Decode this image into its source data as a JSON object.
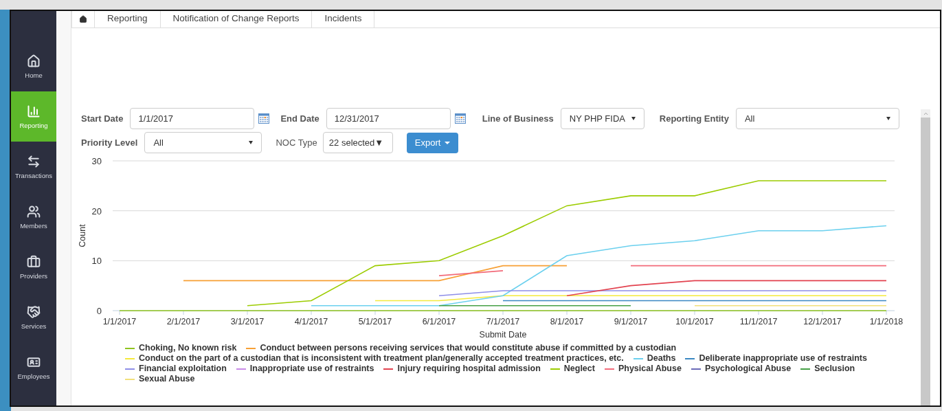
{
  "sidebar": {
    "items": [
      {
        "label": "Home",
        "selected": false
      },
      {
        "label": "Reporting",
        "selected": true
      },
      {
        "label": "Transactions",
        "selected": false
      },
      {
        "label": "Members",
        "selected": false
      },
      {
        "label": "Providers",
        "selected": false
      },
      {
        "label": "Services",
        "selected": false
      },
      {
        "label": "Employees",
        "selected": false
      }
    ]
  },
  "breadcrumb": [
    "Reporting",
    "Notification of Change Reports",
    "Incidents"
  ],
  "filters": {
    "start_date": {
      "label": "Start Date",
      "value": "1/1/2017"
    },
    "end_date": {
      "label": "End Date",
      "value": "12/31/2017"
    },
    "line_of_business": {
      "label": "Line of Business",
      "value": "NY PHP FIDA"
    },
    "reporting_entity": {
      "label": "Reporting Entity",
      "value": "All"
    },
    "priority_level": {
      "label": "Priority Level",
      "value": "All"
    },
    "noc_type": {
      "label": "NOC Type",
      "value": "22 selected▼"
    },
    "export_button": "Export"
  },
  "chart_data": {
    "type": "line",
    "xlabel": "Submit Date",
    "ylabel": "Count",
    "categories": [
      "1/1/2017",
      "2/1/2017",
      "3/1/2017",
      "4/1/2017",
      "5/1/2017",
      "6/1/2017",
      "7/1/2017",
      "8/1/2017",
      "9/1/2017",
      "10/1/2017",
      "11/1/2017",
      "12/1/2017",
      "1/1/2018"
    ],
    "ylim": [
      0,
      30
    ],
    "yticks": [
      0,
      10,
      20,
      30
    ],
    "series": [
      {
        "name": "Choking, No known risk",
        "color": "#8fc31f",
        "values": [
          0,
          0,
          0,
          0,
          0,
          0,
          0,
          0,
          0,
          0,
          0,
          0,
          0
        ]
      },
      {
        "name": "Conduct between persons receiving services that would constitute abuse if committed by a custodian",
        "color": "#f7a035",
        "values": [
          null,
          6,
          6,
          6,
          6,
          6,
          9,
          9,
          null,
          null,
          null,
          null,
          null
        ]
      },
      {
        "name": "Conduct on the part of a custodian that is inconsistent with treatment plan/generally accepted treatment practices, etc.",
        "color": "#f4e93a",
        "values": [
          null,
          null,
          null,
          null,
          2,
          2,
          3,
          3,
          3,
          3,
          3,
          3,
          3
        ]
      },
      {
        "name": "Deaths",
        "color": "#6bd0ee",
        "values": [
          null,
          null,
          null,
          1,
          1,
          1,
          3,
          11,
          13,
          14,
          16,
          16,
          17
        ]
      },
      {
        "name": "Deliberate inappropriate use of restraints",
        "color": "#3a87c2",
        "values": [
          null,
          null,
          null,
          null,
          null,
          null,
          2,
          2,
          2,
          2,
          2,
          2,
          2
        ]
      },
      {
        "name": "Financial exploitation",
        "color": "#8e8ee8",
        "values": [
          null,
          null,
          null,
          null,
          null,
          3,
          4,
          4,
          4,
          4,
          4,
          4,
          4
        ]
      },
      {
        "name": "Inappropriate use of restraints",
        "color": "#c98ae8",
        "values": [
          null,
          null,
          null,
          null,
          null,
          null,
          null,
          null,
          null,
          null,
          null,
          null,
          null
        ]
      },
      {
        "name": "Injury requiring hospital admission",
        "color": "#e2424f",
        "values": [
          null,
          null,
          null,
          null,
          null,
          null,
          null,
          3,
          5,
          6,
          6,
          6,
          6
        ]
      },
      {
        "name": "Neglect",
        "color": "#9ccc00",
        "values": [
          null,
          null,
          1,
          2,
          9,
          10,
          15,
          21,
          23,
          23,
          26,
          26,
          26
        ]
      },
      {
        "name": "Physical Abuse",
        "color": "#f26b7a",
        "values": [
          null,
          null,
          null,
          null,
          null,
          7,
          8,
          null,
          9,
          9,
          9,
          9,
          9
        ]
      },
      {
        "name": "Psychological Abuse",
        "color": "#6a6ab8",
        "values": [
          null,
          null,
          null,
          null,
          null,
          null,
          null,
          null,
          null,
          null,
          null,
          null,
          null
        ]
      },
      {
        "name": "Seclusion",
        "color": "#46a046",
        "values": [
          null,
          null,
          null,
          null,
          null,
          1,
          1,
          1,
          1,
          null,
          null,
          null,
          null
        ]
      },
      {
        "name": "Sexual Abuse",
        "color": "#f2e07a",
        "values": [
          null,
          null,
          null,
          null,
          null,
          null,
          null,
          null,
          null,
          1,
          1,
          1,
          1
        ]
      }
    ]
  }
}
